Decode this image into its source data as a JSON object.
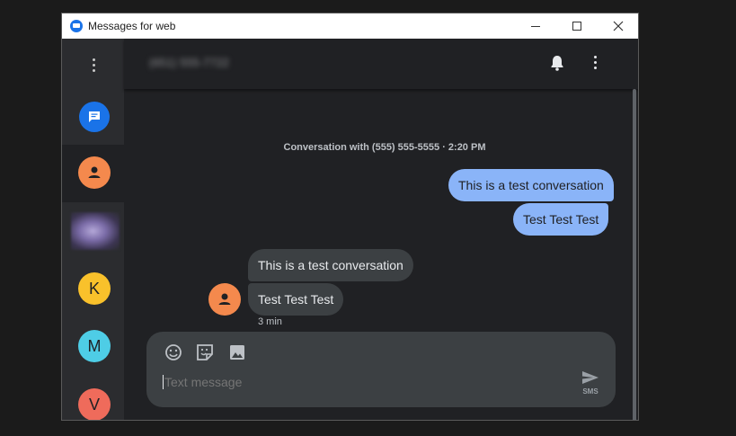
{
  "window": {
    "title": "Messages for web"
  },
  "rail": {
    "contacts": [
      {
        "initial": "",
        "color": "#f4894d"
      },
      {
        "initial": "",
        "color": "blurred"
      },
      {
        "initial": "K",
        "color": "#f9c12b"
      },
      {
        "initial": "M",
        "color": "#4ecde6"
      },
      {
        "initial": "V",
        "color": "#ef6b5b"
      }
    ]
  },
  "header": {
    "phone": "(651) 555-7722"
  },
  "conversation": {
    "header": "Conversation with (555) 555-5555 · 2:20 PM",
    "outgoing": [
      "This is a test conversation",
      "Test Test Test"
    ],
    "incoming": [
      "This is a test conversation",
      "Test Test Test"
    ],
    "incoming_time": "3 min"
  },
  "compose": {
    "placeholder": "Text message",
    "send_label": "SMS"
  },
  "colors": {
    "accent": "#1a73e8",
    "outgoing_bubble": "#8ab4f8",
    "incoming_bubble": "#3c4043",
    "background": "#202124"
  }
}
